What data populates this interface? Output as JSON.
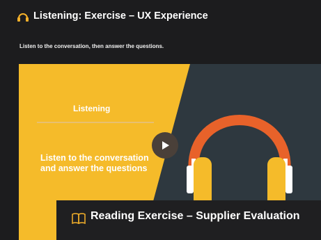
{
  "header": {
    "icon": "headphones-icon",
    "title": "Listening: Exercise – UX Experience"
  },
  "instructions": "Listen to the conversation, then answer the questions.",
  "video": {
    "heading": "Listening",
    "body": "Listen to the conversation and answer the questions",
    "play_icon": "play-icon",
    "colors": {
      "yellow": "#f5bb2a",
      "dark": "#2e383f",
      "orange": "#e8622a"
    }
  },
  "reading": {
    "icon": "book-icon",
    "title": "Reading Exercise – Supplier Evaluation"
  }
}
